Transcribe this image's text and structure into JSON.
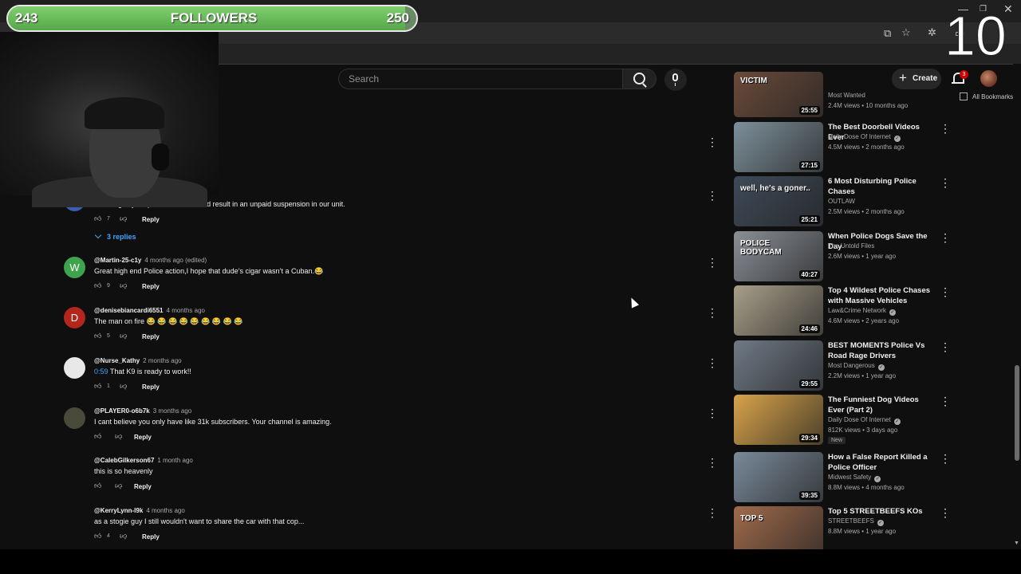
{
  "overlay": {
    "followers_current": "243",
    "followers_label": "FOLLOWERS",
    "followers_goal": "250",
    "follower_progress": 0.972,
    "counter": "10"
  },
  "browser": {
    "bookmarks_label": "All Bookmarks"
  },
  "header": {
    "search_placeholder": "Search",
    "create_label": "Create",
    "notifications_count": "3"
  },
  "comments": [
    {
      "avatar_letter": "",
      "avatar_color": "#3b5fb0",
      "author": "",
      "age": "",
      "text": "Smoking in your patrol vehicle would result in an unpaid suspension in our unit.",
      "likes": "7",
      "reply": "Reply"
    },
    {
      "avatar_letter": "W",
      "avatar_color": "#3fa34d",
      "author": "@Martin-25-c1y",
      "age": "4 months ago (edited)",
      "text": "Great high end Police action,I hope that dude’s cigar wasn’t a Cuban.😂",
      "likes": "9",
      "reply": "Reply"
    },
    {
      "avatar_letter": "D",
      "avatar_color": "#b3261e",
      "author": "@denisebiancardi6551",
      "age": "4 months ago",
      "text": "The man on fire 😂 😂 😂  😂 😂 😂 😂 😂 😂",
      "likes": "5",
      "reply": "Reply"
    },
    {
      "avatar_letter": "",
      "avatar_color": "#e8e8e8",
      "author": "@Nurse_Kathy",
      "age": "2 months ago",
      "timestamp": "0:59",
      "text": "That K9 is ready to work!!",
      "likes": "1",
      "reply": "Reply"
    },
    {
      "avatar_letter": "",
      "avatar_color": "#4a4a3a",
      "author": "@PLAYER0-o6b7k",
      "age": "3 months ago",
      "text": "I cant believe you only have like 31k subscribers. Your channel is amazing.",
      "likes": "",
      "reply": "Reply"
    },
    {
      "avatar_letter": "",
      "avatar_color": "",
      "author": "@CalebGilkerson67",
      "age": "1 month ago",
      "text": "this is so heavenly",
      "likes": "",
      "reply": "Reply"
    },
    {
      "avatar_letter": "",
      "avatar_color": "",
      "author": "@KerryLynn-l9k",
      "age": "4 months ago",
      "text": "as a stogie guy I still wouldn't want to share the car with that cop...",
      "likes": "4",
      "reply": "Reply"
    }
  ],
  "replies_toggle": "3 replies",
  "recommendations": [
    {
      "title": "",
      "channel": "Most Wanted",
      "verified": false,
      "stats": "2.4M views • 10 months ago",
      "duration": "25:55",
      "thumb_text": "VICTIM",
      "thumb_bg": "#6b4a3a"
    },
    {
      "title": "The Best Doorbell Videos Ever",
      "channel": "Daily Dose Of Internet",
      "verified": true,
      "stats": "4.5M views • 2 months ago",
      "duration": "27:15",
      "thumb_text": "",
      "thumb_bg": "#7d8f9a"
    },
    {
      "title": "6 Most Disturbing Police Chases",
      "channel": "OUTLAW",
      "verified": false,
      "stats": "2.5M views • 2 months ago",
      "duration": "25:21",
      "thumb_text": "well, he's a goner..",
      "thumb_bg": "#3e4a58"
    },
    {
      "title": "When Police Dogs Save the Day",
      "channel": "The Untold Files",
      "verified": false,
      "stats": "2.6M views • 1 year ago",
      "duration": "40:27",
      "thumb_text": "POLICE BODYCAM",
      "thumb_bg": "#8a8f96"
    },
    {
      "title": "Top 4 Wildest Police Chases with Massive Vehicles",
      "channel": "Law&Crime Network",
      "verified": true,
      "stats": "4.6M views • 2 years ago",
      "duration": "24:46",
      "thumb_text": "",
      "thumb_bg": "#a89f8a"
    },
    {
      "title": "BEST MOMENTS Police Vs Road Rage Drivers",
      "channel": "Most Dangerous",
      "verified": true,
      "stats": "2.2M views • 1 year ago",
      "duration": "29:55",
      "thumb_text": "",
      "thumb_bg": "#6f7a86"
    },
    {
      "title": "The Funniest Dog Videos Ever (Part 2)",
      "channel": "Daily Dose Of Internet",
      "verified": true,
      "stats": "812K views • 3 days ago",
      "duration": "29:34",
      "thumb_text": "",
      "thumb_bg": "#d8a34a",
      "badge": "New"
    },
    {
      "title": "How a False Report Killed a Police Officer",
      "channel": "Midwest Safety",
      "verified": true,
      "stats": "8.8M views • 4 months ago",
      "duration": "39:35",
      "thumb_text": "",
      "thumb_bg": "#7a8a9a"
    },
    {
      "title": "Top 5 STREETBEEFS KOs",
      "channel": "STREETBEEFS",
      "verified": true,
      "stats": "8.8M views • 1 year ago",
      "duration": "",
      "thumb_text": "TOP 5",
      "thumb_bg": "#a06a4a"
    }
  ]
}
